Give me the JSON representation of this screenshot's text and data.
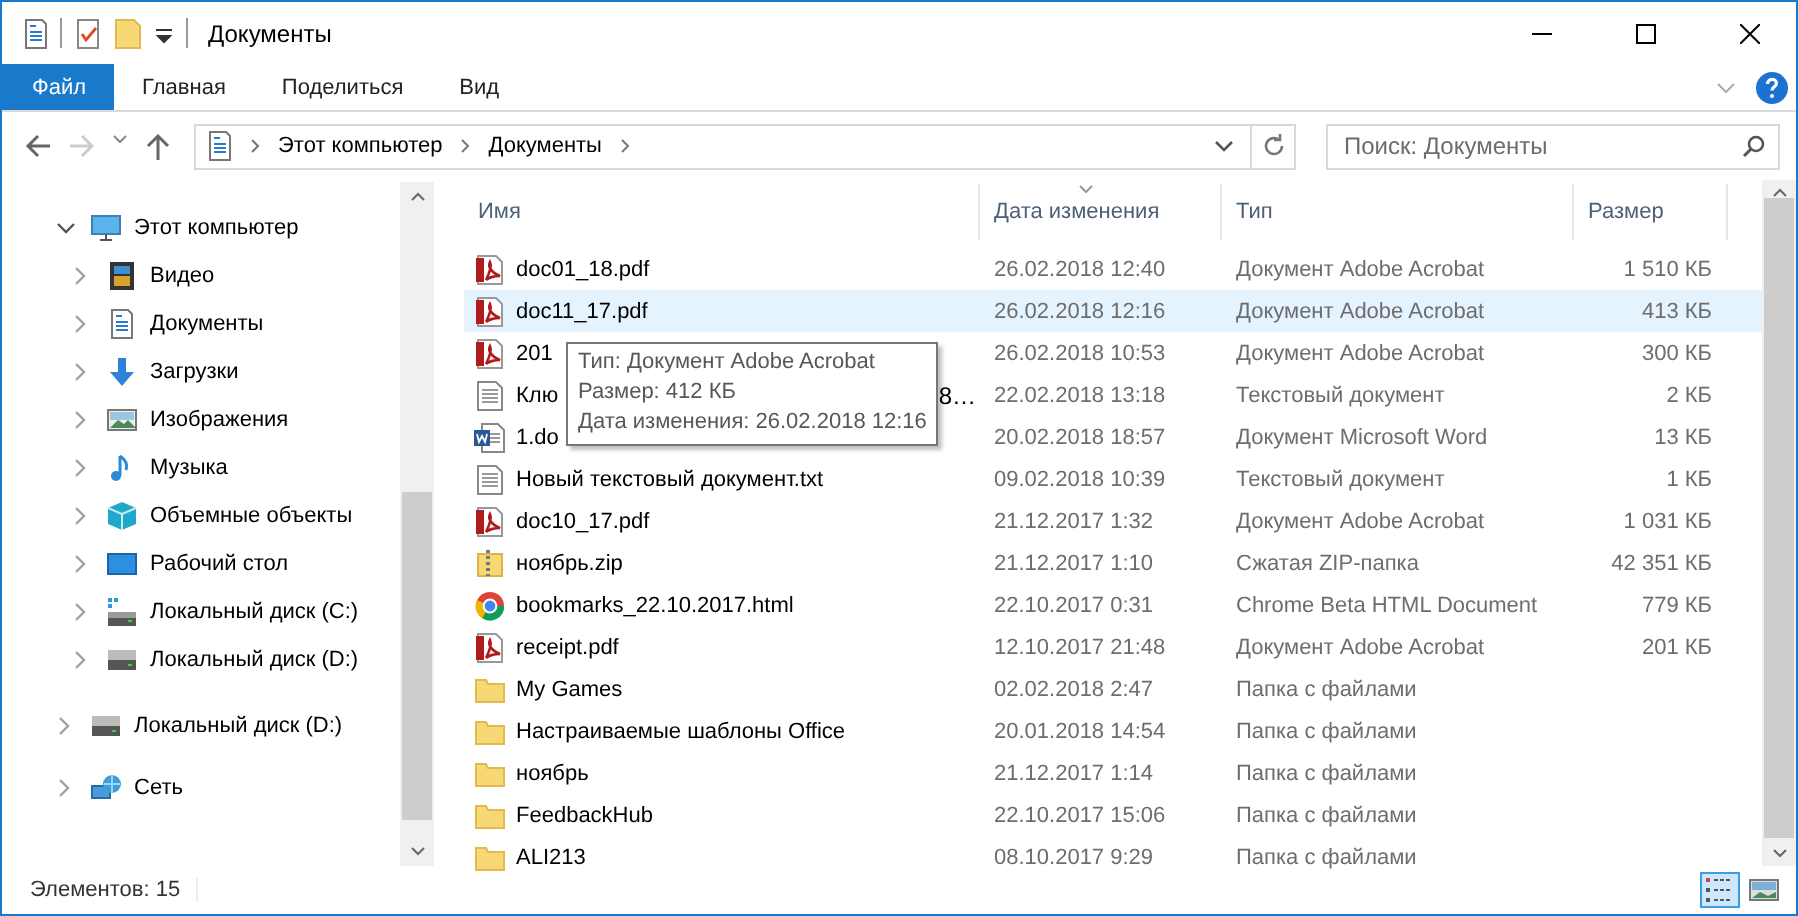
{
  "window": {
    "title": "Документы"
  },
  "ribbon_tabs": [
    {
      "label": "Файл",
      "selected": true
    },
    {
      "label": "Главная",
      "selected": false
    },
    {
      "label": "Поделиться",
      "selected": false
    },
    {
      "label": "Вид",
      "selected": false
    }
  ],
  "breadcrumb": [
    "Этот компьютер",
    "Документы"
  ],
  "search": {
    "placeholder": "Поиск: Документы"
  },
  "nav": [
    {
      "label": "Этот компьютер",
      "expanded": true,
      "children": [
        {
          "label": "Видео",
          "expanded": false
        },
        {
          "label": "Документы",
          "expanded": false
        },
        {
          "label": "Загрузки",
          "expanded": false
        },
        {
          "label": "Изображения",
          "expanded": false
        },
        {
          "label": "Музыка",
          "expanded": false
        },
        {
          "label": "Объемные объекты",
          "expanded": false
        },
        {
          "label": "Рабочий стол",
          "expanded": false
        },
        {
          "label": "Локальный диск (C:)",
          "expanded": false
        },
        {
          "label": "Локальный диск (D:)",
          "expanded": false
        }
      ]
    },
    {
      "label": "Локальный диск (D:)",
      "expanded": false
    },
    {
      "label": "Сеть",
      "expanded": false
    }
  ],
  "table": {
    "columns": [
      {
        "label": "Имя",
        "sorted": false
      },
      {
        "label": "Дата изменения",
        "sorted": true
      },
      {
        "label": "Тип",
        "sorted": false
      },
      {
        "label": "Размер",
        "sorted": false
      }
    ],
    "rows": [
      {
        "kind": "pdf",
        "name": "doc01_18.pdf",
        "date": "26.02.2018 12:40",
        "type": "Документ Adobe Acrobat",
        "size": "1 510 КБ",
        "selected": false
      },
      {
        "kind": "pdf",
        "name": "doc11_17.pdf",
        "date": "26.02.2018 12:16",
        "type": "Документ Adobe Acrobat",
        "size": "413 КБ",
        "selected": true
      },
      {
        "kind": "pdf",
        "name": "201",
        "date": "26.02.2018 10:53",
        "type": "Документ Adobe Acrobat",
        "size": "300 КБ",
        "selected": false
      },
      {
        "kind": "txt",
        "name": "Клю",
        "name_tail": "8…",
        "date": "22.02.2018 13:18",
        "type": "Текстовый документ",
        "size": "2 КБ",
        "selected": false
      },
      {
        "kind": "word",
        "name": "1.do",
        "date": "20.02.2018 18:57",
        "type": "Документ Microsoft Word",
        "size": "13 КБ",
        "selected": false
      },
      {
        "kind": "txt",
        "name": "Новый текстовый документ.txt",
        "date": "09.02.2018 10:39",
        "type": "Текстовый документ",
        "size": "1 КБ",
        "selected": false
      },
      {
        "kind": "pdf",
        "name": "doc10_17.pdf",
        "date": "21.12.2017 1:32",
        "type": "Документ Adobe Acrobat",
        "size": "1 031 КБ",
        "selected": false
      },
      {
        "kind": "zip",
        "name": "ноябрь.zip",
        "date": "21.12.2017 1:10",
        "type": "Сжатая ZIP-папка",
        "size": "42 351 КБ",
        "selected": false
      },
      {
        "kind": "html",
        "name": "bookmarks_22.10.2017.html",
        "date": "22.10.2017 0:31",
        "type": "Chrome Beta HTML Document",
        "size": "779 КБ",
        "selected": false
      },
      {
        "kind": "pdf",
        "name": "receipt.pdf",
        "date": "12.10.2017 21:48",
        "type": "Документ Adobe Acrobat",
        "size": "201 КБ",
        "selected": false
      },
      {
        "kind": "folder",
        "name": "My Games",
        "date": "02.02.2018 2:47",
        "type": "Папка с файлами",
        "selected": false
      },
      {
        "kind": "folder",
        "name": "Настраиваемые шаблоны Office",
        "date": "20.01.2018 14:54",
        "type": "Папка с файлами",
        "selected": false
      },
      {
        "kind": "folder",
        "name": "ноябрь",
        "date": "21.12.2017 1:14",
        "type": "Папка с файлами",
        "selected": false
      },
      {
        "kind": "folder",
        "name": "FeedbackHub",
        "date": "22.10.2017 15:06",
        "type": "Папка с файлами",
        "selected": false
      },
      {
        "kind": "folder",
        "name": "ALI213",
        "date": "08.10.2017 9:29",
        "type": "Папка с файлами",
        "selected": false
      }
    ]
  },
  "tooltip": [
    "Тип: Документ Adobe Acrobat",
    "Размер: 412 КБ",
    "Дата изменения: 26.02.2018 12:16"
  ],
  "status_bar": {
    "items_count": "Элементов: 15"
  },
  "view_buttons": [
    {
      "kind": "details",
      "selected": true
    },
    {
      "kind": "tiles",
      "selected": false
    }
  ]
}
